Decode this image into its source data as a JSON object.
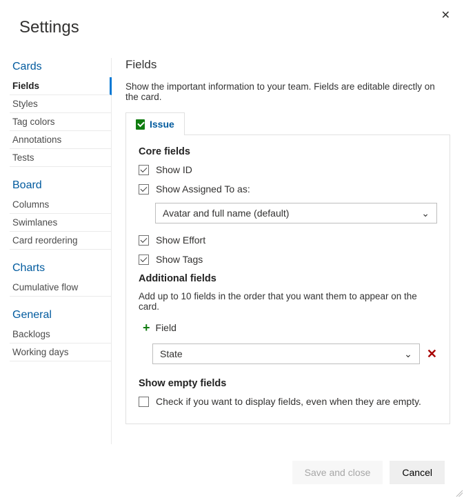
{
  "header": {
    "title": "Settings"
  },
  "sidebar": {
    "sections": [
      {
        "title": "Cards",
        "items": [
          {
            "label": "Fields",
            "selected": true,
            "name": "sidebar-fields"
          },
          {
            "label": "Styles",
            "name": "sidebar-styles"
          },
          {
            "label": "Tag colors",
            "name": "sidebar-tag-colors"
          },
          {
            "label": "Annotations",
            "name": "sidebar-annotations"
          },
          {
            "label": "Tests",
            "name": "sidebar-tests"
          }
        ]
      },
      {
        "title": "Board",
        "items": [
          {
            "label": "Columns",
            "name": "sidebar-columns"
          },
          {
            "label": "Swimlanes",
            "name": "sidebar-swimlanes"
          },
          {
            "label": "Card reordering",
            "name": "sidebar-card-reordering"
          }
        ]
      },
      {
        "title": "Charts",
        "items": [
          {
            "label": "Cumulative flow",
            "name": "sidebar-cumulative-flow"
          }
        ]
      },
      {
        "title": "General",
        "items": [
          {
            "label": "Backlogs",
            "name": "sidebar-backlogs"
          },
          {
            "label": "Working days",
            "name": "sidebar-working-days"
          }
        ]
      }
    ]
  },
  "main": {
    "title": "Fields",
    "description": "Show the important information to your team. Fields are editable directly on the card.",
    "tab": {
      "label": "Issue",
      "icon": "issue-icon"
    },
    "core_fields_heading": "Core fields",
    "show_id": {
      "label": "Show ID",
      "checked": true
    },
    "show_assigned": {
      "label": "Show Assigned To as:",
      "checked": true
    },
    "assigned_select": {
      "value": "Avatar and full name (default)"
    },
    "show_effort": {
      "label": "Show Effort",
      "checked": true
    },
    "show_tags": {
      "label": "Show Tags",
      "checked": true
    },
    "additional_heading": "Additional fields",
    "additional_subtext": "Add up to 10 fields in the order that you want them to appear on the card.",
    "add_field_label": "Field",
    "added_field_select": {
      "value": "State"
    },
    "empty_heading": "Show empty fields",
    "empty_checkbox": {
      "label": "Check if you want to display fields, even when they are empty.",
      "checked": false
    }
  },
  "footer": {
    "save_label": "Save and close",
    "cancel_label": "Cancel"
  }
}
